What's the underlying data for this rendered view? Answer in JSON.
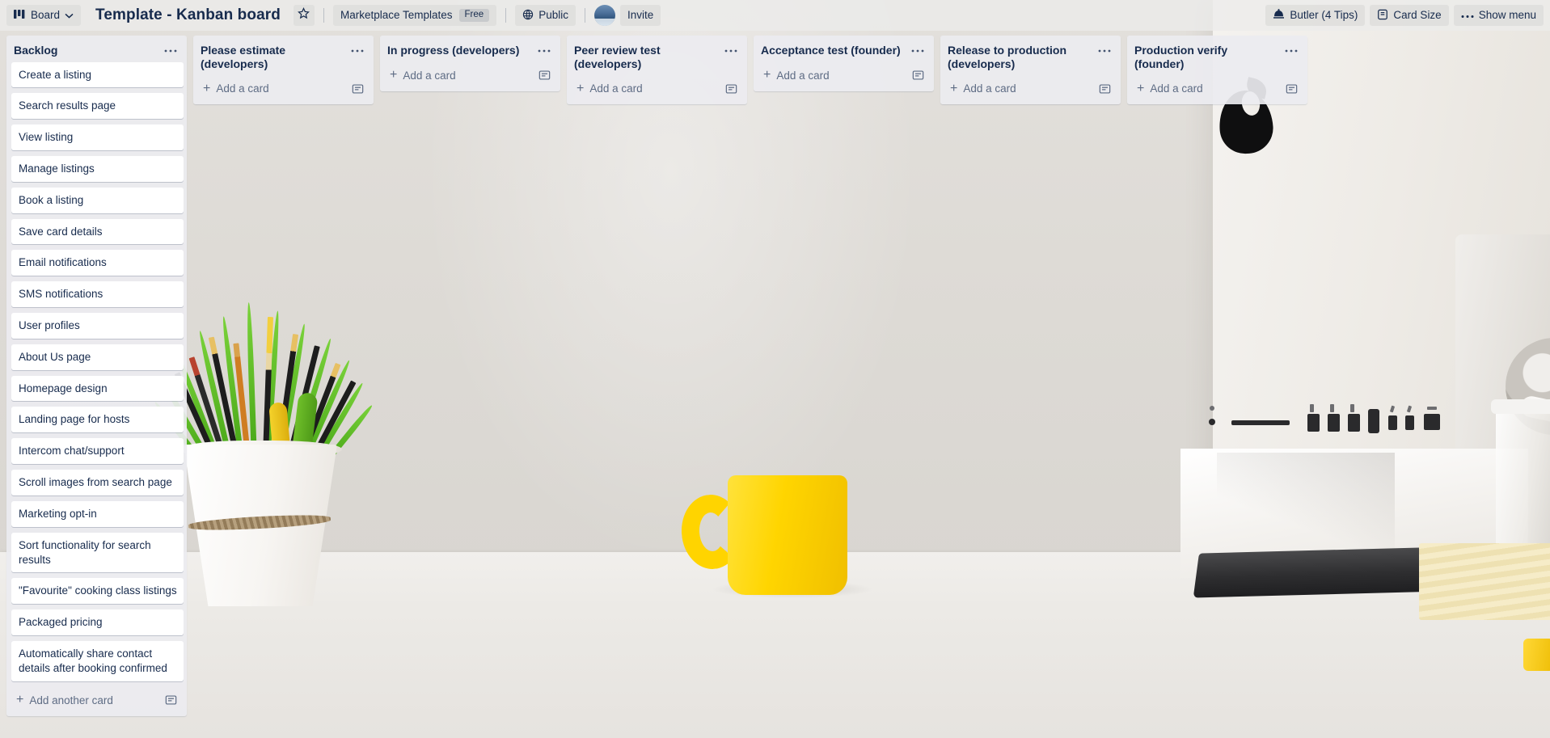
{
  "topbar": {
    "board_switcher": {
      "label": "Board",
      "icon": "board-icon",
      "chevron": "chevron-down-icon"
    },
    "board_title": "Template - Kanban board",
    "star_icon": "star-icon",
    "workspace": {
      "label": "Marketplace Templates",
      "badge": "Free"
    },
    "visibility": {
      "label": "Public",
      "icon": "globe-icon"
    },
    "avatar": {
      "name": "member-avatar"
    },
    "invite_label": "Invite",
    "butler_label": "Butler (4 Tips)",
    "butler_icon": "butler-icon",
    "card_size_label": "Card Size",
    "card_size_icon": "card-size-icon",
    "show_menu_label": "Show menu",
    "show_menu_icon": "ellipsis-icon"
  },
  "ui": {
    "add_card_label": "Add a card",
    "add_another_card_label": "Add another card",
    "list_menu_icon": "ellipsis-icon",
    "card_template_icon": "card-template-icon",
    "plus_icon": "plus-icon"
  },
  "colors": {
    "topbar_bg": "#ececea",
    "list_bg": "#ebecf0",
    "card_bg": "#ffffff",
    "text_primary": "#172b4d",
    "text_muted": "#5e6c84"
  },
  "lists": [
    {
      "title": "Backlog",
      "footer_label": "Add another card",
      "has_scrollbar": true,
      "cards": [
        "Create a listing",
        "Search results page",
        "View listing",
        "Manage listings",
        "Book a listing",
        "Save card details",
        "Email notifications",
        "SMS notifications",
        "User profiles",
        "About Us page",
        "Homepage design",
        "Landing page for hosts",
        "Intercom chat/support",
        "Scroll images from search page",
        "Marketing opt-in",
        "Sort functionality for search results",
        "\"Favourite\" cooking class listings",
        "Packaged pricing",
        "Automatically share contact details after booking confirmed"
      ]
    },
    {
      "title": "Please estimate (developers)",
      "footer_label": "Add a card",
      "has_scrollbar": false,
      "cards": []
    },
    {
      "title": "In progress (developers)",
      "footer_label": "Add a card",
      "has_scrollbar": false,
      "cards": []
    },
    {
      "title": "Peer review test (developers)",
      "footer_label": "Add a card",
      "has_scrollbar": false,
      "cards": []
    },
    {
      "title": "Acceptance test (founder)",
      "footer_label": "Add a card",
      "has_scrollbar": false,
      "cards": []
    },
    {
      "title": "Release to production (developers)",
      "footer_label": "Add a card",
      "has_scrollbar": false,
      "cards": []
    },
    {
      "title": "Production verify (founder)",
      "footer_label": "Add a card",
      "has_scrollbar": false,
      "cards": []
    }
  ]
}
